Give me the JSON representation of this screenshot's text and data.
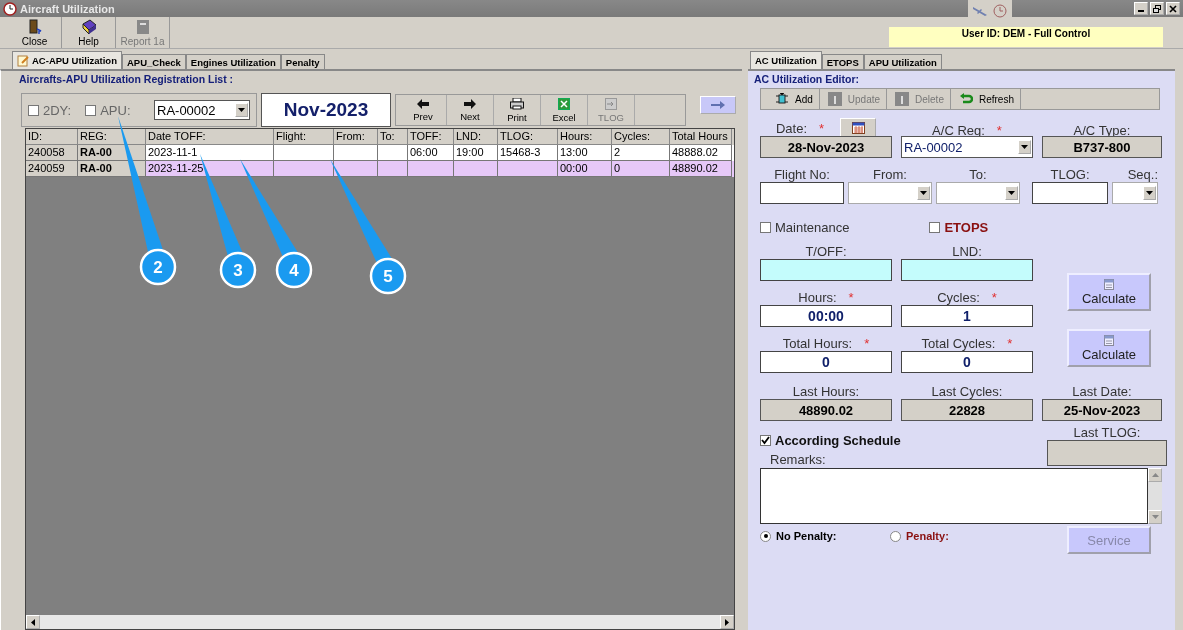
{
  "window": {
    "title": "Aircraft Utilization",
    "user_id": "User ID: DEM - Full Control"
  },
  "toolbar": [
    {
      "label": "Close",
      "kind": "close",
      "disabled": false
    },
    {
      "label": "Help",
      "kind": "help",
      "disabled": false
    },
    {
      "label": "Report 1a",
      "kind": "report",
      "disabled": true
    }
  ],
  "left_tabs": [
    {
      "label": "AC-APU Utilization",
      "selected": true
    },
    {
      "label": "APU_Check",
      "selected": false
    },
    {
      "label": "Engines Utilization",
      "selected": false
    },
    {
      "label": "Penalty",
      "selected": false
    }
  ],
  "list": {
    "title": "Aircrafts-APU Utilization Registration List :",
    "filters": [
      {
        "label": "2DY:",
        "checked": false
      },
      {
        "label": "APU:",
        "checked": false
      }
    ],
    "reg": "RA-00002",
    "month": "Nov-2023",
    "nav_buttons": [
      {
        "label": "Prev",
        "kind": "prev",
        "disabled": false
      },
      {
        "label": "Next",
        "kind": "next",
        "disabled": false
      },
      {
        "label": "Print",
        "kind": "print",
        "disabled": false
      },
      {
        "label": "Excel",
        "kind": "excel",
        "disabled": false
      },
      {
        "label": "TLOG",
        "kind": "tlog",
        "disabled": true
      }
    ],
    "columns": [
      "ID:",
      "REG:",
      "Date TOFF:",
      "Flight:",
      "From:",
      "To:",
      "TOFF:",
      "LND:",
      "TLOG:",
      "Hours:",
      "Cycles:",
      "Total Hours"
    ],
    "rows": [
      {
        "selected": false,
        "cells": [
          "240058",
          "RA-00",
          "2023-11-1",
          "",
          "",
          "",
          "06:00",
          "19:00",
          "15468-3",
          "13:00",
          "2",
          "48888.02"
        ]
      },
      {
        "selected": true,
        "cells": [
          "240059",
          "RA-00",
          "2023-11-25",
          "",
          "",
          "",
          "",
          "",
          "",
          "00:00",
          "0",
          "48890.02"
        ]
      }
    ]
  },
  "callouts": [
    "2",
    "3",
    "4",
    "5"
  ],
  "right_tabs": [
    {
      "label": "AC Utilization",
      "selected": true
    },
    {
      "label": "ETOPS",
      "selected": false
    },
    {
      "label": "APU Utilization",
      "selected": false
    }
  ],
  "editor": {
    "title": "AC Utilization Editor:",
    "required_mark": "*",
    "actions": [
      {
        "label": "Add",
        "kind": "add",
        "disabled": false
      },
      {
        "label": "Update",
        "kind": "update",
        "disabled": true
      },
      {
        "label": "Delete",
        "kind": "delete",
        "disabled": true
      },
      {
        "label": "Refresh",
        "kind": "refresh",
        "disabled": false
      }
    ],
    "date": {
      "label": "Date:",
      "value": "28-Nov-2023"
    },
    "ac_reg": {
      "label": "A/C Reg:",
      "value": "RA-00002"
    },
    "ac_type": {
      "label": "A/C Type:",
      "value": "B737-800"
    },
    "flight_no": {
      "label": "Flight No:"
    },
    "from": {
      "label": "From:"
    },
    "to": {
      "label": "To:"
    },
    "tlog": {
      "label": "TLOG:"
    },
    "seq": {
      "label": "Seq.:"
    },
    "maintenance": {
      "label": "Maintenance",
      "checked": false
    },
    "etops": {
      "label": "ETOPS",
      "checked": false
    },
    "toff": {
      "label": "T/OFF:"
    },
    "lnd": {
      "label": "LND:"
    },
    "hours": {
      "label": "Hours:",
      "value": "00:00"
    },
    "cycles": {
      "label": "Cycles:",
      "value": "1"
    },
    "total_hours": {
      "label": "Total Hours:",
      "value": "0"
    },
    "total_cycles": {
      "label": "Total Cycles:",
      "value": "0"
    },
    "calculate_buttons": [
      "Calculate",
      "Calculate"
    ],
    "last_hours": {
      "label": "Last Hours:",
      "value": "48890.02"
    },
    "last_cycles": {
      "label": "Last Cycles:",
      "value": "22828"
    },
    "last_date": {
      "label": "Last Date:",
      "value": "25-Nov-2023"
    },
    "according_schedule": {
      "label": "According Schedule",
      "checked": true
    },
    "last_tlog": {
      "label": "Last TLOG:"
    },
    "remarks": {
      "label": "Remarks:"
    },
    "penalty_options": [
      {
        "label": "No Penalty:",
        "selected": true
      },
      {
        "label": "Penalty:",
        "selected": false
      }
    ],
    "service": {
      "label": "Service",
      "disabled": true
    }
  }
}
